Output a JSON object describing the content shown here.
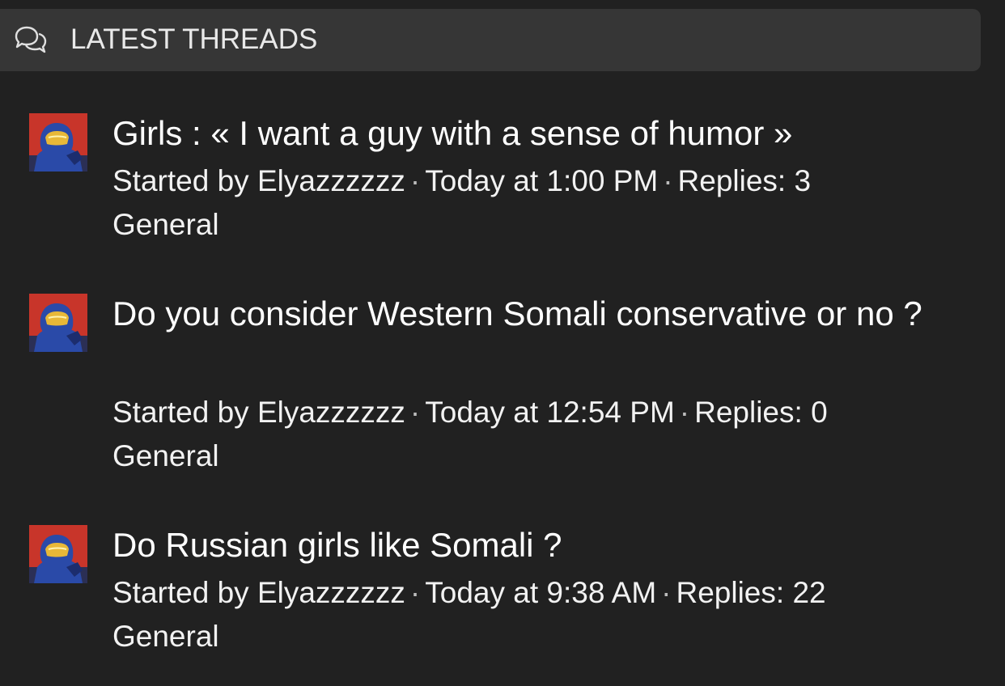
{
  "header": {
    "title": "LATEST THREADS",
    "icon": "comments-icon"
  },
  "threads": [
    {
      "title": "Girls : « I want a guy with a sense of humor »",
      "started_by_prefix": "Started by",
      "author": "Elyazzzzzz",
      "time": "Today at 1:00 PM",
      "replies_label": "Replies:",
      "replies": "3",
      "forum": "General"
    },
    {
      "title": "Do you consider Western Somali conservative or no ?",
      "started_by_prefix": "Started by",
      "author": "Elyazzzzzz",
      "time": "Today at 12:54 PM",
      "replies_label": "Replies:",
      "replies": "0",
      "forum": "General"
    },
    {
      "title": "Do Russian girls like Somali ?",
      "started_by_prefix": "Started by",
      "author": "Elyazzzzzz",
      "time": "Today at 9:38 AM",
      "replies_label": "Replies:",
      "replies": "22",
      "forum": "General"
    }
  ],
  "colors": {
    "background": "#212121",
    "header_bg": "#363636",
    "text": "#ffffff",
    "avatar_bg": "#c8352a",
    "avatar_helmet": "#2a4aa8",
    "avatar_visor": "#e8b838"
  }
}
